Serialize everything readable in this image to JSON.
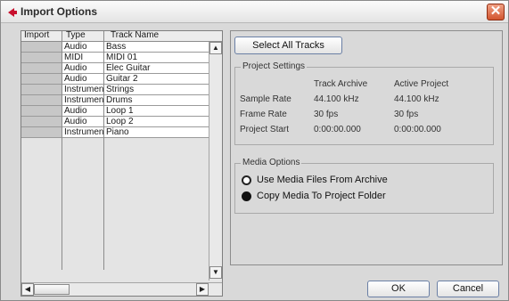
{
  "window": {
    "title": "Import Options",
    "close_glyph": "✕"
  },
  "tracklist": {
    "columns": [
      "Import",
      "Type",
      "Track Name"
    ],
    "rows": [
      {
        "type": "Audio",
        "name": "Bass"
      },
      {
        "type": "MIDI",
        "name": "MIDI 01"
      },
      {
        "type": "Audio",
        "name": "Elec Guitar"
      },
      {
        "type": "Audio",
        "name": "Guitar 2"
      },
      {
        "type": "Instrumen",
        "name": "Strings"
      },
      {
        "type": "Instrumen",
        "name": "Drums"
      },
      {
        "type": "Audio",
        "name": "Loop 1"
      },
      {
        "type": "Audio",
        "name": "Loop 2"
      },
      {
        "type": "Instrumen",
        "name": "Piano"
      }
    ],
    "scroll_up": "▲",
    "scroll_down": "▼",
    "scroll_left": "◀",
    "scroll_right": "▶"
  },
  "select_all_label": "Select All Tracks",
  "project_settings": {
    "title": "Project Settings",
    "col_track_archive": "Track Archive",
    "col_active_project": "Active Project",
    "rows": [
      {
        "label": "Sample Rate",
        "archive": "44.100 kHz",
        "active": "44.100 kHz"
      },
      {
        "label": "Frame Rate",
        "archive": "30 fps",
        "active": "30 fps"
      },
      {
        "label": "Project Start",
        "archive": "0:00:00.000",
        "active": "0:00:00.000"
      }
    ]
  },
  "media_options": {
    "title": "Media Options",
    "option_use": "Use Media Files From Archive",
    "option_copy": "Copy Media To Project Folder",
    "selected": "option_copy"
  },
  "buttons": {
    "ok": "OK",
    "cancel": "Cancel"
  },
  "colors": {
    "accent_close": "#d2552f",
    "icon_red": "#c8102e"
  }
}
